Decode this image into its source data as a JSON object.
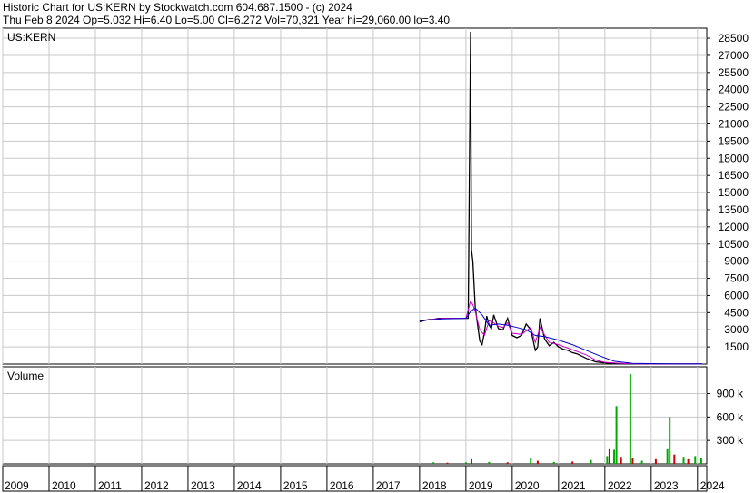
{
  "header": {
    "line1": "Historic Chart for US:KERN by Stockwatch.com 604.687.1500 - (c) 2024",
    "line2": "Thu Feb  8 2024  Op=5.032  Hi=6.40  Lo=5.00  Cl=6.272  Vol=70,321  Year hi=29,060.00  lo=3.40"
  },
  "colors": {
    "background": "#ffffff",
    "grid": "#c8c8c8",
    "price": "#000000",
    "ma_short": "#d000d0",
    "ma_long": "#0000cc",
    "volume_up": "#00aa00",
    "volume_down": "#cc0000"
  },
  "chart_data": [
    {
      "type": "line",
      "title": "US:KERN",
      "xlim": [
        2009,
        2024.2
      ],
      "ylim": [
        0,
        29060
      ],
      "grid": true,
      "yticks": [
        1500,
        3000,
        4500,
        6000,
        7500,
        9000,
        10500,
        12000,
        13500,
        15000,
        16500,
        18000,
        19500,
        21000,
        22500,
        24000,
        25500,
        27000,
        28500
      ],
      "ytick_labels": [
        "1500",
        "3000",
        "4500",
        "6000",
        "7500",
        "9000",
        "10500",
        "12000",
        "13500",
        "15000",
        "16500",
        "18000",
        "19500",
        "21000",
        "22500",
        "24000",
        "25500",
        "27000",
        "28500"
      ],
      "series": [
        {
          "x": [
            2018.0,
            2018.1,
            2018.2,
            2018.3,
            2018.4,
            2018.5,
            2018.6,
            2018.7,
            2018.8,
            2018.9,
            2019.0,
            2019.05,
            2019.1,
            2019.12,
            2019.15,
            2019.2,
            2019.25,
            2019.3,
            2019.35,
            2019.4,
            2019.45,
            2019.5,
            2019.55,
            2019.6,
            2019.7,
            2019.8,
            2019.9,
            2020.0,
            2020.1,
            2020.2,
            2020.3,
            2020.4,
            2020.5,
            2020.55,
            2020.6,
            2020.7,
            2020.8,
            2020.9,
            2021.0,
            2021.1,
            2021.2,
            2021.3,
            2021.4,
            2021.5,
            2021.6,
            2021.8,
            2022.0,
            2022.2,
            2022.4,
            2022.6,
            2022.8,
            2023.0,
            2023.5,
            2024.0,
            2024.1
          ],
          "values": [
            3700,
            3800,
            3900,
            3900,
            4000,
            4000,
            4000,
            4000,
            4000,
            4000,
            4000,
            4000,
            29060,
            10000,
            9000,
            5000,
            3500,
            2000,
            1700,
            2800,
            4200,
            3400,
            3100,
            4300,
            3100,
            3000,
            4000,
            2500,
            2300,
            2500,
            3500,
            3000,
            1200,
            1500,
            4000,
            2200,
            1600,
            1900,
            1500,
            1300,
            1200,
            1000,
            900,
            700,
            500,
            200,
            100,
            60,
            30,
            20,
            10,
            7,
            5,
            5,
            6
          ]
        },
        {
          "x": [
            2018.0,
            2018.5,
            2019.0,
            2019.1,
            2019.15,
            2019.2,
            2019.3,
            2019.4,
            2019.5,
            2019.6,
            2019.7,
            2019.8,
            2019.9,
            2020.0,
            2020.2,
            2020.4,
            2020.5,
            2020.6,
            2020.8,
            2021.0,
            2021.2,
            2021.4,
            2021.6,
            2021.8,
            2022.0,
            2022.4,
            2022.8,
            2023.5,
            2024.1
          ],
          "values": [
            3800,
            4000,
            4000,
            5500,
            5200,
            4600,
            3000,
            2500,
            3800,
            3600,
            3300,
            3200,
            3600,
            2700,
            2600,
            3200,
            1900,
            3200,
            1900,
            1700,
            1400,
            1100,
            800,
            350,
            150,
            50,
            15,
            6,
            6
          ]
        },
        {
          "x": [
            2018.0,
            2018.5,
            2019.0,
            2019.1,
            2019.2,
            2019.35,
            2019.5,
            2019.7,
            2019.9,
            2020.1,
            2020.3,
            2020.5,
            2020.7,
            2021.0,
            2021.3,
            2021.6,
            2021.9,
            2022.2,
            2022.6,
            2023.5,
            2024.1
          ],
          "values": [
            3800,
            3950,
            4000,
            4600,
            4900,
            4300,
            3400,
            3500,
            3400,
            3200,
            3000,
            2500,
            2400,
            2100,
            1700,
            1200,
            700,
            250,
            60,
            10,
            8
          ]
        }
      ]
    },
    {
      "type": "bar",
      "title": "Volume",
      "xlim": [
        2009,
        2024.2
      ],
      "ylim": [
        0,
        1150000
      ],
      "grid": true,
      "yticks": [
        300000,
        600000,
        900000
      ],
      "ytick_labels": [
        "300 k",
        "600 k",
        "900 k"
      ],
      "x_tick_labels": [
        "2009",
        "2010",
        "2011",
        "2012",
        "2013",
        "2014",
        "2015",
        "2016",
        "2017",
        "2018",
        "2019",
        "2020",
        "2021",
        "2022",
        "2023",
        "2024"
      ],
      "x_tick_positions": [
        2009,
        2010,
        2011,
        2012,
        2013,
        2014,
        2015,
        2016,
        2017,
        2018,
        2019,
        2020,
        2021,
        2022,
        2023,
        2024
      ],
      "bars": [
        {
          "x": 2018.3,
          "value": 20000,
          "dir": "up"
        },
        {
          "x": 2018.6,
          "value": 15000,
          "dir": "down"
        },
        {
          "x": 2019.0,
          "value": 20000,
          "dir": "up"
        },
        {
          "x": 2019.12,
          "value": 60000,
          "dir": "down"
        },
        {
          "x": 2019.5,
          "value": 25000,
          "dir": "up"
        },
        {
          "x": 2019.9,
          "value": 20000,
          "dir": "down"
        },
        {
          "x": 2020.4,
          "value": 70000,
          "dir": "up"
        },
        {
          "x": 2020.55,
          "value": 40000,
          "dir": "down"
        },
        {
          "x": 2020.9,
          "value": 25000,
          "dir": "up"
        },
        {
          "x": 2021.3,
          "value": 30000,
          "dir": "down"
        },
        {
          "x": 2021.7,
          "value": 50000,
          "dir": "up"
        },
        {
          "x": 2022.05,
          "value": 100000,
          "dir": "up"
        },
        {
          "x": 2022.1,
          "value": 200000,
          "dir": "down"
        },
        {
          "x": 2022.2,
          "value": 180000,
          "dir": "up"
        },
        {
          "x": 2022.25,
          "value": 740000,
          "dir": "up"
        },
        {
          "x": 2022.35,
          "value": 90000,
          "dir": "down"
        },
        {
          "x": 2022.55,
          "value": 1150000,
          "dir": "up"
        },
        {
          "x": 2022.6,
          "value": 80000,
          "dir": "down"
        },
        {
          "x": 2022.8,
          "value": 40000,
          "dir": "up"
        },
        {
          "x": 2023.1,
          "value": 60000,
          "dir": "down"
        },
        {
          "x": 2023.35,
          "value": 200000,
          "dir": "up"
        },
        {
          "x": 2023.4,
          "value": 600000,
          "dir": "up"
        },
        {
          "x": 2023.5,
          "value": 120000,
          "dir": "down"
        },
        {
          "x": 2023.7,
          "value": 90000,
          "dir": "up"
        },
        {
          "x": 2023.8,
          "value": 60000,
          "dir": "down"
        },
        {
          "x": 2023.95,
          "value": 100000,
          "dir": "up"
        },
        {
          "x": 2024.08,
          "value": 70000,
          "dir": "up"
        }
      ]
    }
  ]
}
